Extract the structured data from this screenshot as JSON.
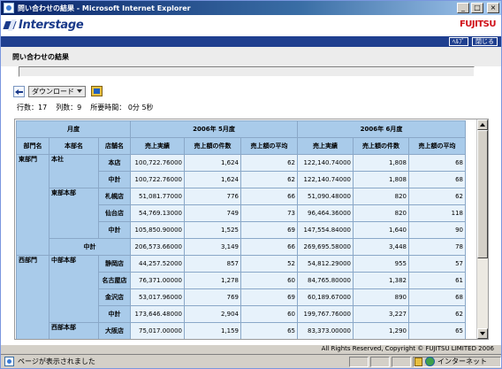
{
  "window": {
    "title": "問い合わせの結果 - Microsoft Internet Explorer"
  },
  "header": {
    "logo_text": "Interstage",
    "brand": "FUJITSU"
  },
  "nav": {
    "help_label": "ﾍﾙﾌﾟ",
    "close_label": "閉じる"
  },
  "page": {
    "title": "問い合わせの結果"
  },
  "toolbar": {
    "download_label": "ダウンロード"
  },
  "stats": {
    "rows": "行数：17",
    "cols": "列数：9",
    "time": "所要時間： 0分 5秒"
  },
  "table": {
    "month_label": "月度",
    "period1": "2006年 5月度",
    "period2": "2006年 6月度",
    "col_dept": "部門名",
    "col_hq": "本部名",
    "col_store": "店舗名",
    "col_amount": "売上実績",
    "col_count": "売上額の件数",
    "col_avg": "売上額の平均",
    "rows": [
      {
        "dept": "東部門",
        "hq": "本社",
        "store": "本店",
        "amt1": "100,722.76000",
        "cnt1": "1,624",
        "avg1": "62",
        "amt2": "122,140.74000",
        "cnt2": "1,808",
        "avg2": "68"
      },
      {
        "dept": "",
        "hq": "",
        "store": "中計",
        "amt1": "100,722.76000",
        "cnt1": "1,624",
        "avg1": "62",
        "amt2": "122,140.74000",
        "cnt2": "1,808",
        "avg2": "68"
      },
      {
        "dept": "",
        "hq": "東部本部",
        "store": "札幌店",
        "amt1": "51,081.77000",
        "cnt1": "776",
        "avg1": "66",
        "amt2": "51,090.48000",
        "cnt2": "820",
        "avg2": "62"
      },
      {
        "dept": "",
        "hq": "",
        "store": "仙台店",
        "amt1": "54,769.13000",
        "cnt1": "749",
        "avg1": "73",
        "amt2": "96,464.36000",
        "cnt2": "820",
        "avg2": "118"
      },
      {
        "dept": "",
        "hq": "",
        "store": "中計",
        "amt1": "105,850.90000",
        "cnt1": "1,525",
        "avg1": "69",
        "amt2": "147,554.84000",
        "cnt2": "1,640",
        "avg2": "90"
      },
      {
        "dept": "",
        "hq": "中計",
        "store": "",
        "amt1": "206,573.66000",
        "cnt1": "3,149",
        "avg1": "66",
        "amt2": "269,695.58000",
        "cnt2": "3,448",
        "avg2": "78"
      },
      {
        "dept": "西部門",
        "hq": "中部本部",
        "store": "静岡店",
        "amt1": "44,257.52000",
        "cnt1": "857",
        "avg1": "52",
        "amt2": "54,812.29000",
        "cnt2": "955",
        "avg2": "57"
      },
      {
        "dept": "",
        "hq": "",
        "store": "名古屋店",
        "amt1": "76,371.00000",
        "cnt1": "1,278",
        "avg1": "60",
        "amt2": "84,765.80000",
        "cnt2": "1,382",
        "avg2": "61"
      },
      {
        "dept": "",
        "hq": "",
        "store": "金沢店",
        "amt1": "53,017.96000",
        "cnt1": "769",
        "avg1": "69",
        "amt2": "60,189.67000",
        "cnt2": "890",
        "avg2": "68"
      },
      {
        "dept": "",
        "hq": "",
        "store": "中計",
        "amt1": "173,646.48000",
        "cnt1": "2,904",
        "avg1": "60",
        "amt2": "199,767.76000",
        "cnt2": "3,227",
        "avg2": "62"
      },
      {
        "dept": "",
        "hq": "西部本部",
        "store": "大阪店",
        "amt1": "75,017.00000",
        "cnt1": "1,159",
        "avg1": "65",
        "amt2": "83,373.00000",
        "cnt2": "1,290",
        "avg2": "65"
      }
    ]
  },
  "footer": {
    "copyright": "All Rights Reserved, Copyright © FUJITSU LIMITED 2006"
  },
  "statusbar": {
    "text": "ページが表示されました",
    "zone": "インターネット"
  }
}
